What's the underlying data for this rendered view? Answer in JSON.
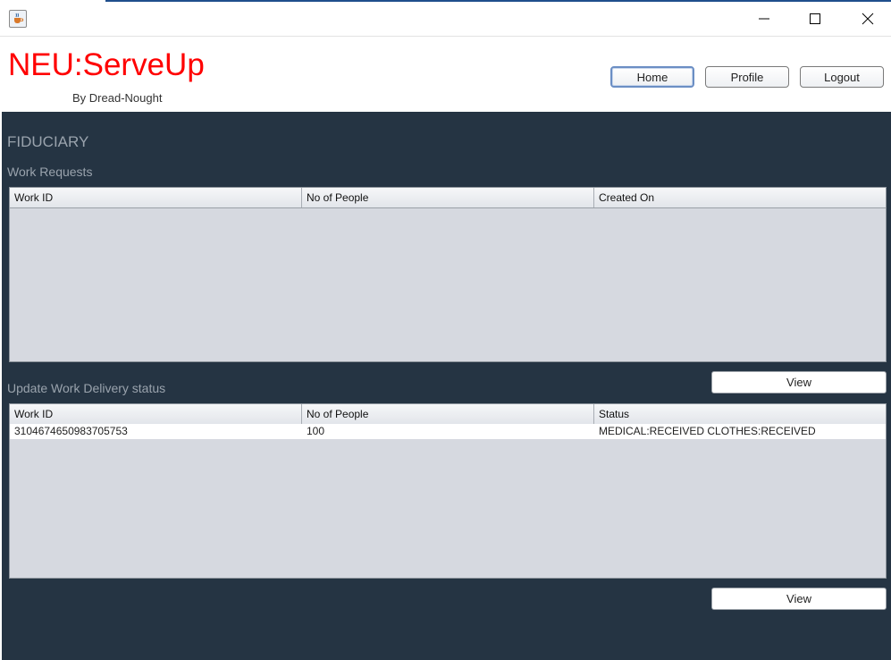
{
  "window": {
    "icons": {
      "app": "java-cup-icon",
      "minimize": "minimize-icon",
      "maximize": "maximize-icon",
      "close": "close-icon"
    }
  },
  "header": {
    "brand": "NEU:ServeUp",
    "byline": "By Dread-Nought",
    "nav": {
      "home": "Home",
      "profile": "Profile",
      "logout": "Logout"
    }
  },
  "main": {
    "role_title": "FIDUCIARY",
    "work_requests": {
      "title": "Work Requests",
      "columns": [
        "Work ID",
        "No of People",
        "Created On"
      ],
      "rows": [],
      "view_label": "View"
    },
    "delivery": {
      "title": "Update Work Delivery status",
      "columns": [
        "Work ID",
        "No of People",
        "Status"
      ],
      "rows": [
        [
          "3104674650983705753",
          "100",
          "MEDICAL:RECEIVED CLOTHES:RECEIVED"
        ]
      ],
      "view_label": "View"
    }
  },
  "colors": {
    "brand": "#ff0000",
    "panel_bg": "#253443",
    "table_bg": "#d6d9e0",
    "section_text": "#9aa3ad"
  }
}
